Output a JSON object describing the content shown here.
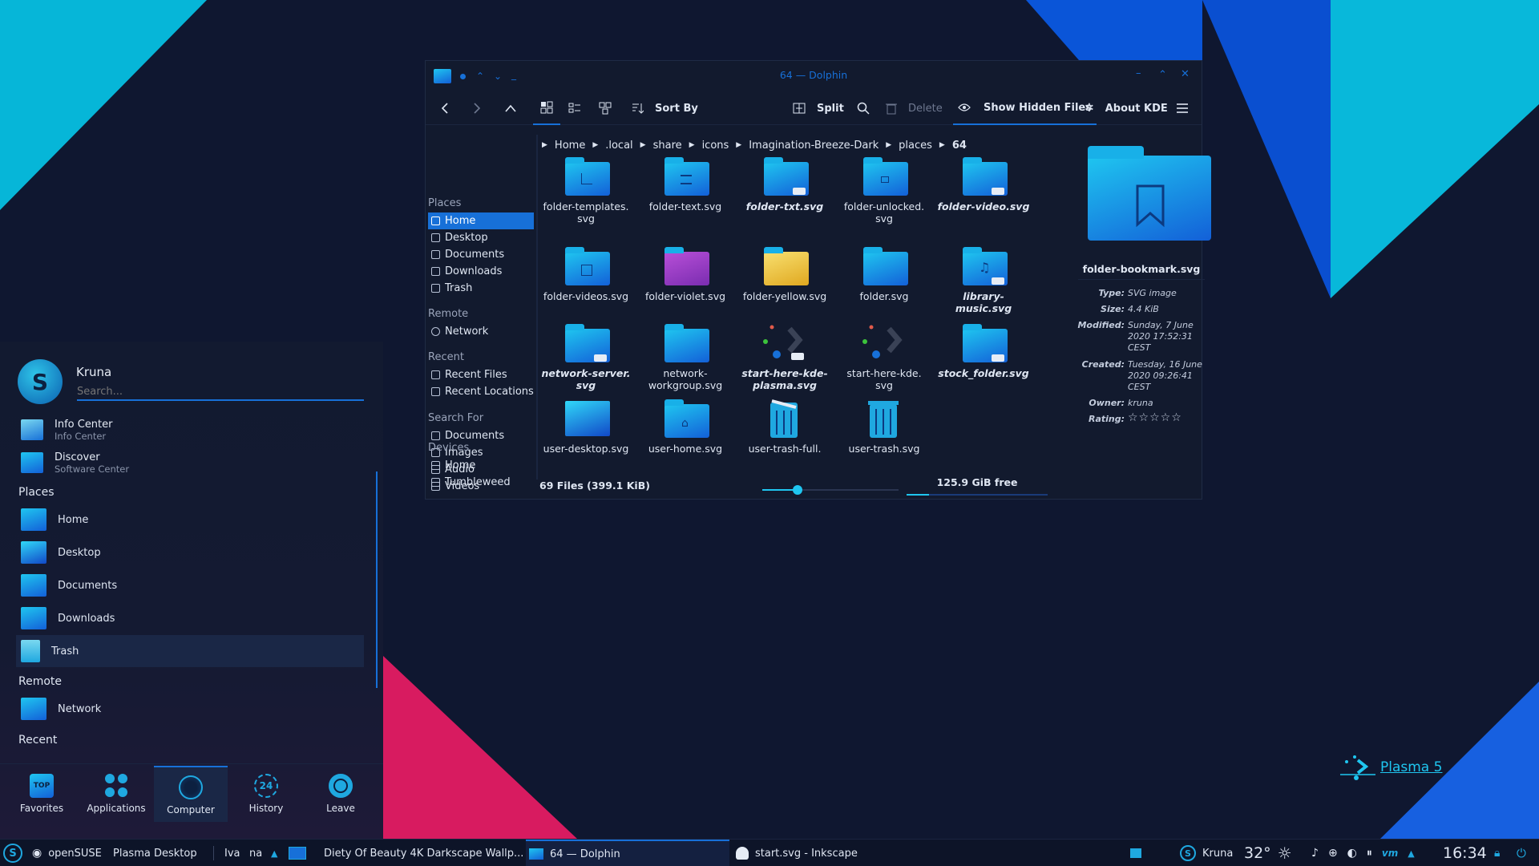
{
  "wallpaper": {
    "colors": [
      "#0f1730",
      "#06b6d8",
      "#0a55d8",
      "#d81b60",
      "#1760e0"
    ]
  },
  "desktop": {
    "plasma_logo_text": "Plasma 5"
  },
  "dolphin": {
    "title": "64 — Dolphin",
    "toolbar": {
      "sort_by": "Sort By",
      "split": "Split",
      "delete": "Delete",
      "show_hidden": "Show Hidden Files",
      "about_kde": "About KDE"
    },
    "places": {
      "sections": [
        {
          "title": "Places",
          "items": [
            "Home",
            "Desktop",
            "Documents",
            "Downloads",
            "Trash"
          ]
        },
        {
          "title": "Remote",
          "items": [
            "Network"
          ]
        },
        {
          "title": "Recent",
          "items": [
            "Recent Files",
            "Recent Locations"
          ]
        },
        {
          "title": "Search For",
          "items": [
            "Documents",
            "Images",
            "Audio",
            "Videos"
          ]
        },
        {
          "title": "Devices",
          "items": [
            "Home",
            "Tumbleweed"
          ]
        }
      ],
      "selected": "Home"
    },
    "breadcrumb": [
      "Home",
      ".local",
      "share",
      "icons",
      "Imagination-Breeze-Dark",
      "places",
      "64"
    ],
    "files": [
      {
        "name": "folder-templates.\nsvg"
      },
      {
        "name": "folder-text.svg"
      },
      {
        "name": "folder-txt.svg"
      },
      {
        "name": "folder-unlocked.\nsvg"
      },
      {
        "name": "folder-video.svg"
      },
      {
        "name": "folder-videos.svg"
      },
      {
        "name": "folder-violet.svg"
      },
      {
        "name": "folder-yellow.svg"
      },
      {
        "name": "folder.svg"
      },
      {
        "name": "library-music.svg"
      },
      {
        "name": "network-server.\nsvg"
      },
      {
        "name": "network-\nworkgroup.svg"
      },
      {
        "name": "start-here-kde-\nplasma.svg"
      },
      {
        "name": "start-here-kde.\nsvg"
      },
      {
        "name": "stock_folder.svg"
      },
      {
        "name": "user-desktop.svg"
      },
      {
        "name": "user-home.svg"
      },
      {
        "name": "user-trash-full."
      },
      {
        "name": "user-trash.svg"
      }
    ],
    "status": {
      "file_count": "69 Files (399.1 KiB)",
      "zoom_level": 0.26,
      "free_space": "125.9 GiB free"
    },
    "info_panel": {
      "filename": "folder-bookmark.svg",
      "type_label": "Type:",
      "type": "SVG image",
      "size_label": "Size:",
      "size": "4.4 KiB",
      "modified_label": "Modified:",
      "modified": "Sunday, 7 June 2020 17:52:31 CEST",
      "created_label": "Created:",
      "created": "Tuesday, 16 June 2020 09:26:41 CEST",
      "owner_label": "Owner:",
      "owner": "kruna",
      "rating_label": "Rating:",
      "rating": 0,
      "rating_stars": "☆☆☆☆☆"
    }
  },
  "launcher": {
    "user": "Kruna",
    "search_placeholder": "Search...",
    "apps": [
      {
        "name": "Info Center",
        "desc": "Info Center"
      },
      {
        "name": "Discover",
        "desc": "Software Center"
      }
    ],
    "places_title": "Places",
    "places": [
      "Home",
      "Desktop",
      "Documents",
      "Downloads",
      "Trash"
    ],
    "remote_title": "Remote",
    "remote": [
      "Network"
    ],
    "recent_title": "Recent",
    "tabs": [
      "Favorites",
      "Applications",
      "Computer",
      "History",
      "Leave"
    ],
    "active_tab": "Computer",
    "tab_badges": {
      "favorites": "TOP",
      "history": "24"
    }
  },
  "taskbar": {
    "opensuse": "openSUSE",
    "plasma_desktop": "Plasma Desktop",
    "pager_1": "Iva",
    "pager_2": "na",
    "tasks": [
      {
        "title": "Diety Of Beauty 4K Darkscape Wallp..."
      },
      {
        "title": "64 — Dolphin"
      },
      {
        "title": "start.svg - Inkscape"
      }
    ],
    "user": "Kruna",
    "temperature": "32°",
    "clock": "16:34",
    "accent": "#1770d8"
  }
}
